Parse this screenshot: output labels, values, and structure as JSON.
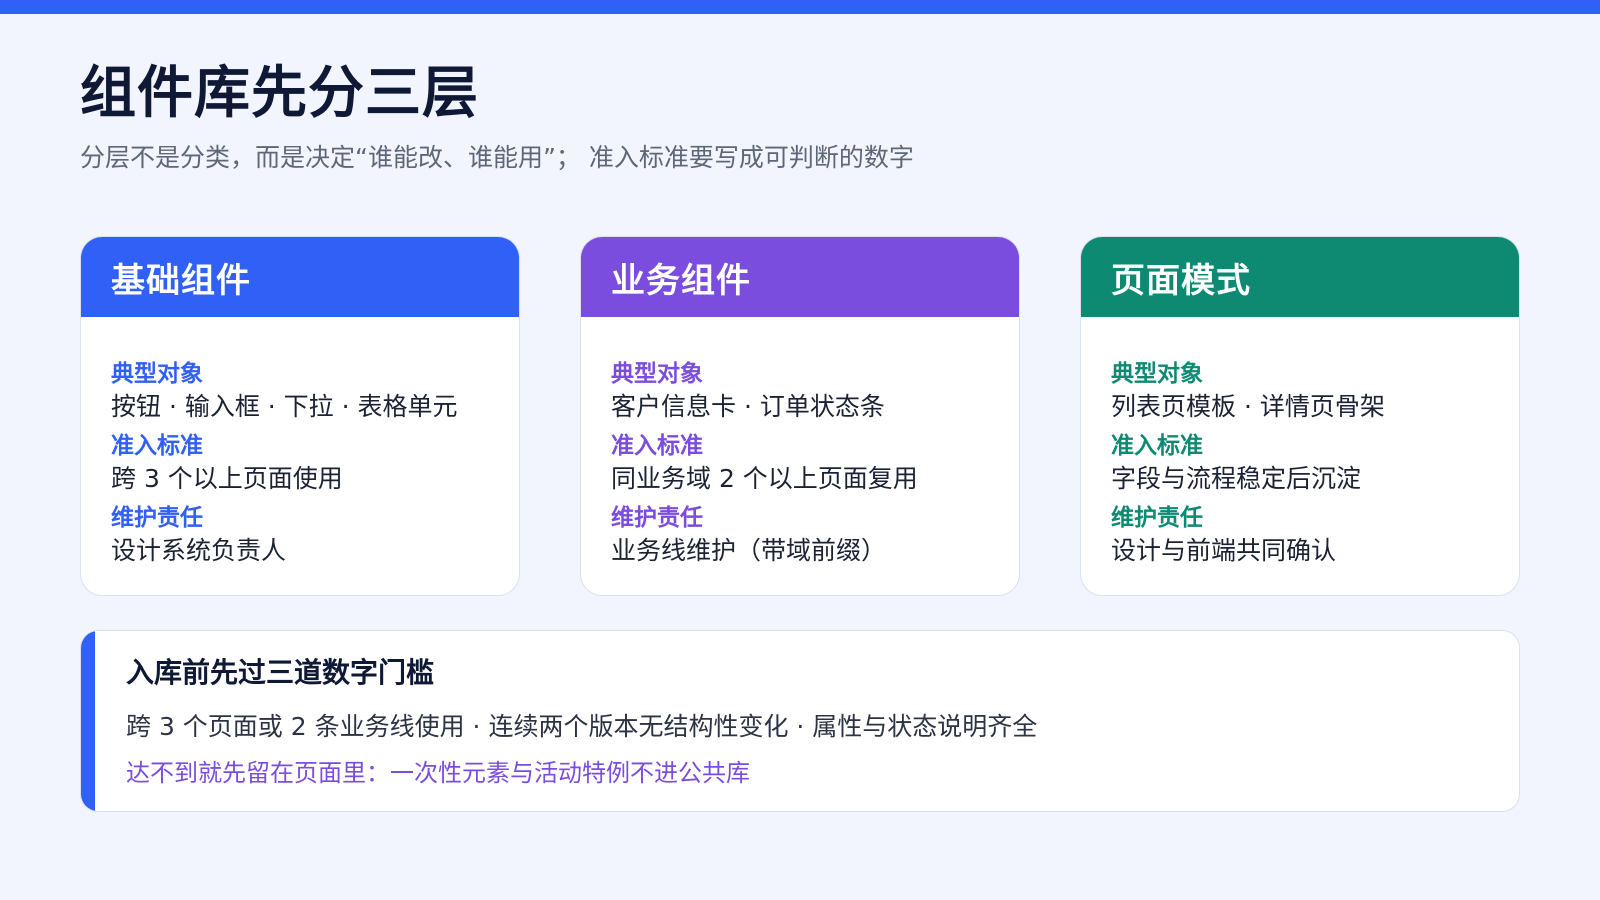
{
  "page": {
    "title": "组件库先分三层",
    "subtitle": "分层不是分类，而是决定“谁能改、谁能用”； 准入标准要写成可判断的数字"
  },
  "colors": {
    "accent_blue": "#3060f6",
    "accent_purple": "#7b4ddf",
    "accent_green": "#0e8a72",
    "background": "#f2f5fd",
    "title_text": "#0f1935"
  },
  "cards": [
    {
      "title": "基础组件",
      "fields": [
        {
          "label": "典型对象",
          "value": "按钮 · 输入框 · 下拉 · 表格单元"
        },
        {
          "label": "准入标准",
          "value": "跨 3 个以上页面使用"
        },
        {
          "label": "维护责任",
          "value": "设计系统负责人"
        }
      ]
    },
    {
      "title": "业务组件",
      "fields": [
        {
          "label": "典型对象",
          "value": "客户信息卡 · 订单状态条"
        },
        {
          "label": "准入标准",
          "value": "同业务域 2 个以上页面复用"
        },
        {
          "label": "维护责任",
          "value": "业务线维护（带域前缀）"
        }
      ]
    },
    {
      "title": "页面模式",
      "fields": [
        {
          "label": "典型对象",
          "value": "列表页模板 · 详情页骨架"
        },
        {
          "label": "准入标准",
          "value": "字段与流程稳定后沉淀"
        },
        {
          "label": "维护责任",
          "value": "设计与前端共同确认"
        }
      ]
    }
  ],
  "note": {
    "title": "入库前先过三道数字门槛",
    "criteria": "跨 3 个页面或 2 条业务线使用 · 连续两个版本无结构性变化 · 属性与状态说明齐全",
    "remark": "达不到就先留在页面里：一次性元素与活动特例不进公共库"
  }
}
